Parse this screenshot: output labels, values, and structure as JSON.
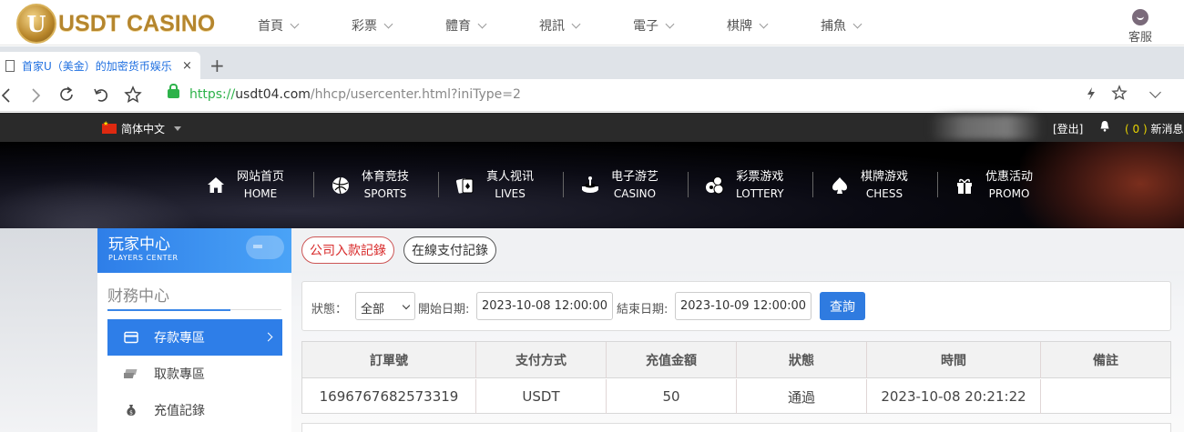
{
  "site": {
    "logo_letter": "U",
    "logo_text": "USDT CASINO",
    "top_nav": [
      "首頁",
      "彩票",
      "體育",
      "視訊",
      "電子",
      "棋牌",
      "捕魚"
    ],
    "service_label": "客服"
  },
  "browser": {
    "tab_title": "首家U（美金）的加密货币娱乐",
    "tab_close": "×",
    "new_tab": "+",
    "url_scheme": "https://",
    "url_host": "usdt04.com",
    "url_path": "/hhcp/usercenter.html?iniType=2",
    "icons": [
      "back-icon",
      "forward-icon",
      "reload-icon",
      "undo-icon",
      "bookmark-star-icon",
      "lock-icon",
      "bolt-icon",
      "star-icon",
      "chevron-down-icon"
    ]
  },
  "header": {
    "language": "简体中文",
    "logout": "[登出]",
    "messages_count": "( 0 )",
    "messages_label": "新消息"
  },
  "main_nav": [
    {
      "cn": "网站首页",
      "en": "HOME",
      "icon": "home-icon"
    },
    {
      "cn": "体育竞技",
      "en": "SPORTS",
      "icon": "ball-icon"
    },
    {
      "cn": "真人视讯",
      "en": "LIVES",
      "icon": "cards-icon"
    },
    {
      "cn": "电子游艺",
      "en": "CASINO",
      "icon": "slot-icon"
    },
    {
      "cn": "彩票游戏",
      "en": "LOTTERY",
      "icon": "lottery-balls-icon"
    },
    {
      "cn": "棋牌游戏",
      "en": "CHESS",
      "icon": "spade-icon"
    },
    {
      "cn": "优惠活动",
      "en": "PROMO",
      "icon": "gift-icon"
    }
  ],
  "sidebar": {
    "title_cn": "玩家中心",
    "title_en": "PLAYERS CENTER",
    "section": "财務中心",
    "items": [
      {
        "label": "存款專區",
        "active": true,
        "icon": "wallet-icon"
      },
      {
        "label": "取款專區",
        "active": false,
        "icon": "cash-icon"
      },
      {
        "label": "充值記錄",
        "active": false,
        "icon": "money-bag-icon"
      }
    ]
  },
  "record_tabs": [
    "公司入款記錄",
    "在線支付記錄"
  ],
  "filter": {
    "status_label": "狀態：",
    "status_value": "全部",
    "start_label": "開始日期:",
    "start_value": "2023-10-08 12:00:00",
    "end_label": "結束日期:",
    "end_value": "2023-10-09 12:00:00",
    "query_button": "查詢"
  },
  "table": {
    "columns": [
      "訂單號",
      "支付方式",
      "充值金額",
      "狀態",
      "時間",
      "備註"
    ],
    "rows": [
      [
        "1696767682573319",
        "USDT",
        "50",
        "通過",
        "2023-10-08 20:21:22",
        ""
      ]
    ]
  },
  "colors": {
    "accent_blue": "#2e7ee8",
    "logo_gold": "#b5862e",
    "tab_red": "#d82a2a",
    "url_green": "#2db24a"
  }
}
